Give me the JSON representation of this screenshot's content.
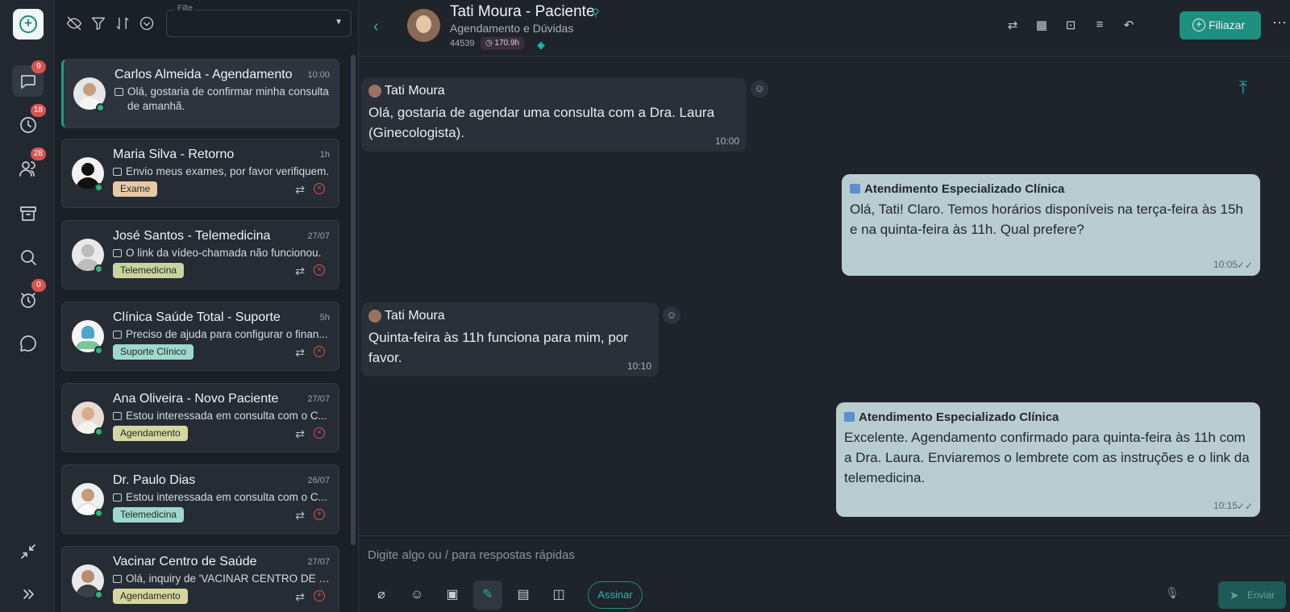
{
  "rail": {
    "badges": {
      "conversations": "9",
      "pending": "18",
      "contacts": "28",
      "alerts": "0"
    }
  },
  "list": {
    "filter_label": "Filte",
    "conversations": [
      {
        "name": "Carlos Almeida - Agendamento",
        "time": "10:00",
        "message": "Olá, gostaria de confirmar minha consulta de amanhã.",
        "tag": ""
      },
      {
        "name": "Maria Silva - Retorno",
        "time": "1h",
        "message": "Envio meus exames, por favor verifiquem.",
        "tag": "Exame"
      },
      {
        "name": "José Santos - Telemedicina",
        "time": "27/07",
        "message": "O link da vídeo-chamada não funcionou.",
        "tag": "Telemedicina"
      },
      {
        "name": "Clínica Saúde Total - Suporte",
        "time": "5h",
        "message": "Preciso de ajuda para configurar o finan...",
        "tag": "Suporte Clínico"
      },
      {
        "name": "Ana Oliveira - Novo Paciente",
        "time": "27/07",
        "message": "Estou interessada em consulta com o C...",
        "tag": "Agendamento"
      },
      {
        "name": "Dr. Paulo Dias",
        "time": "26/07",
        "message": "Estou interessada em consulta com o C...",
        "tag": "Telemedicina"
      },
      {
        "name": "Vacinar Centro de Saúde",
        "time": "27/07",
        "message": "Olá, inquiry de 'VACINAR CENTRO DE SAL...",
        "tag": "Agendamento"
      }
    ]
  },
  "chat": {
    "title": "Tati Moura - Paciente",
    "subtitle": "Agendamento e Dúvidas",
    "id": "44539",
    "hours": "170.9h",
    "filiazar_label": "Filiazar",
    "messages": [
      {
        "author": "Tati Moura",
        "text": "Olá, gostaria de agendar uma consulta com a Dra. Laura (Ginecologista).",
        "time": "10:00"
      },
      {
        "author": "Atendimento Especializado Clínica",
        "text": "Olá, Tati! Claro. Temos horários disponíveis na terça-feira às 15h e na quinta-feira às 11h. Qual prefere?",
        "time": "10:05"
      },
      {
        "author": "Tati Moura",
        "text": "Quinta-feira às 11h funciona para mim, por favor.",
        "time": "10:10"
      },
      {
        "author": "Atendimento Especializado Clínica",
        "text": "Excelente. Agendamento confirmado para quinta-feira às 11h com a Dra. Laura. Enviaremos o lembrete com as instruções e o link da telemedicina.",
        "time": "10:15"
      }
    ],
    "composer_placeholder": "Digite algo ou / para respostas rápidas",
    "sign_label": "Assinar",
    "send_label": "Enviar"
  },
  "colors": {
    "accent": "#1f8f7f",
    "outgoing_bubble": "#b9ccd0",
    "badge": "#d9534f",
    "online": "#2bb673"
  },
  "tag_colors": {
    "Exame": "#e8c9a4",
    "Telemedicina": "#c9d4a0",
    "Suporte Clínico": "#9fd8cc",
    "Agendamento": "#d6d6a0"
  }
}
